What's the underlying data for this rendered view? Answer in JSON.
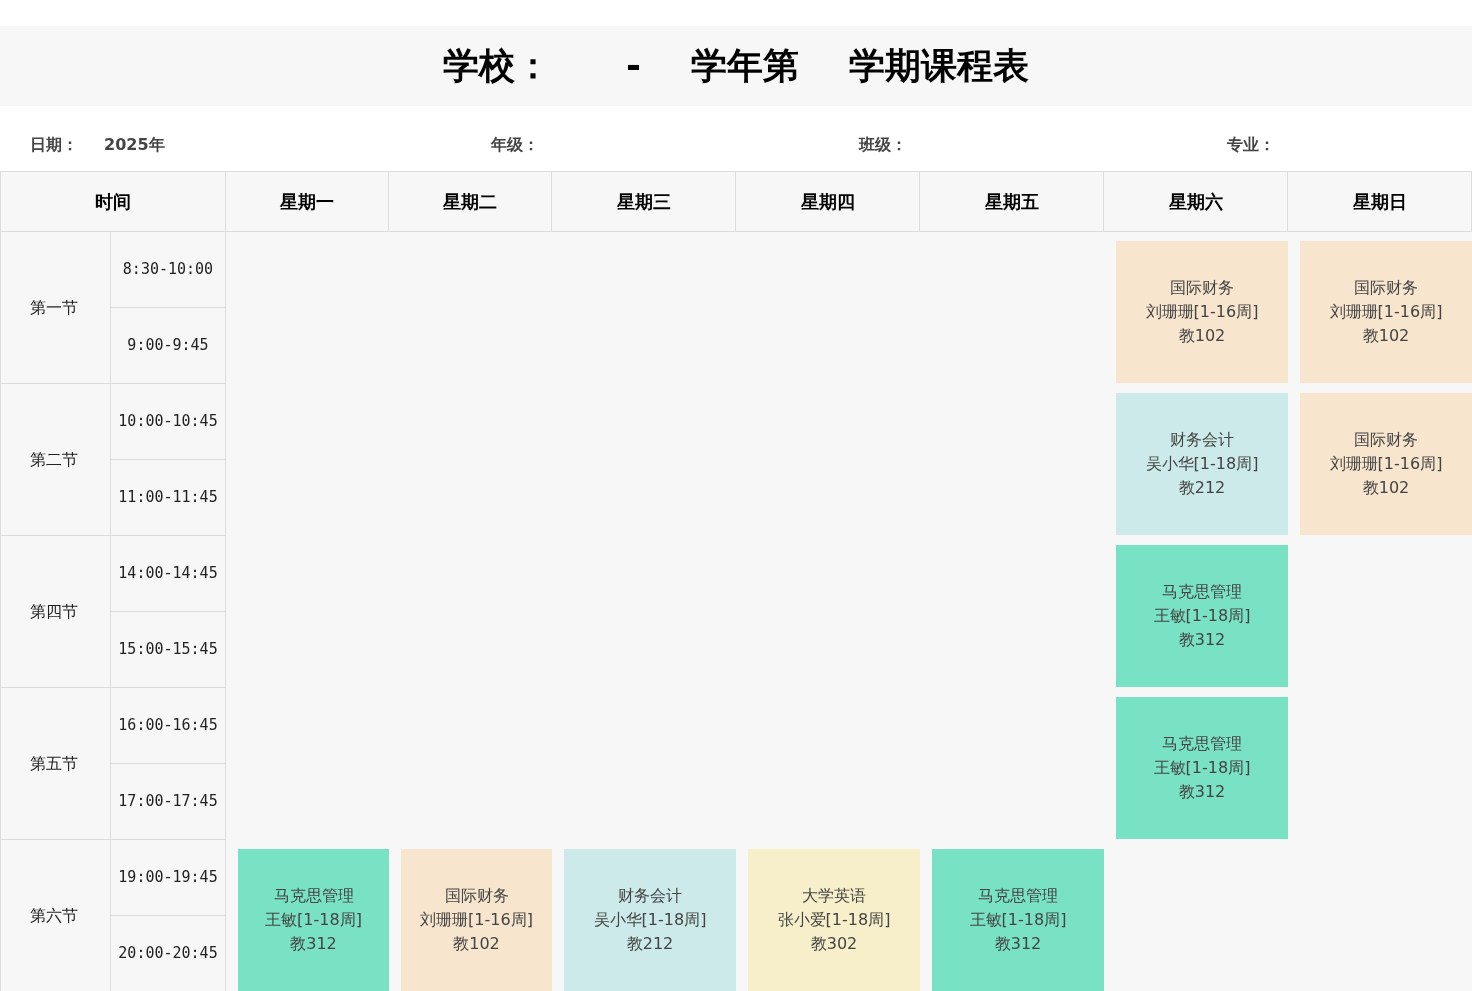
{
  "title": "学校：      -    学年第    学期课程表",
  "info": [
    {
      "label": "日期：",
      "value": "2025年"
    },
    {
      "label": "年级："
    },
    {
      "label": "班级："
    },
    {
      "label": "专业："
    }
  ],
  "table": {
    "columns": [
      "时间",
      "星期一",
      "星期二",
      "星期三",
      "星期四",
      "星期五",
      "星期六",
      "星期日"
    ],
    "periods": [
      {
        "label": "第一节",
        "times": [
          "8:30-10:00",
          "9:00-9:45"
        ],
        "cells": [
          null,
          null,
          null,
          null,
          null,
          {
            "course": "国际财务",
            "teacher": "刘珊珊[1-16周]",
            "room": "教102",
            "color": "#f8e5ce"
          },
          {
            "course": "国际财务",
            "teacher": "刘珊珊[1-16周]",
            "room": "教102",
            "color": "#f8e5ce"
          }
        ]
      },
      {
        "label": "第二节",
        "times": [
          "10:00-10:45",
          "11:00-11:45"
        ],
        "cells": [
          null,
          null,
          null,
          null,
          null,
          {
            "course": "财务会计",
            "teacher": "吴小华[1-18周]",
            "room": "教212",
            "color": "#cdeaea"
          },
          {
            "course": "国际财务",
            "teacher": "刘珊珊[1-16周]",
            "room": "教102",
            "color": "#f8e5ce"
          }
        ]
      },
      {
        "label": "第四节",
        "times": [
          "14:00-14:45",
          "15:00-15:45"
        ],
        "cells": [
          null,
          null,
          null,
          null,
          null,
          {
            "course": "马克思管理",
            "teacher": "王敏[1-18周]",
            "room": "教312",
            "color": "#79e2c4"
          },
          null
        ]
      },
      {
        "label": "第五节",
        "times": [
          "16:00-16:45",
          "17:00-17:45"
        ],
        "cells": [
          null,
          null,
          null,
          null,
          null,
          {
            "course": "马克思管理",
            "teacher": "王敏[1-18周]",
            "room": "教312",
            "color": "#79e2c4"
          },
          null
        ]
      },
      {
        "label": "第六节",
        "times": [
          "19:00-19:45",
          "20:00-20:45"
        ],
        "cells": [
          {
            "course": "马克思管理",
            "teacher": "王敏[1-18周]",
            "room": "教312",
            "color": "#79e2c4"
          },
          {
            "course": "国际财务",
            "teacher": "刘珊珊[1-16周]",
            "room": "教102",
            "color": "#f8e5ce"
          },
          {
            "course": "财务会计",
            "teacher": "吴小华[1-18周]",
            "room": "教212",
            "color": "#cdeaea"
          },
          {
            "course": "大学英语",
            "teacher": "张小爱[1-18周]",
            "room": "教302",
            "color": "#f7efca"
          },
          {
            "course": "马克思管理",
            "teacher": "王敏[1-18周]",
            "room": "教312",
            "color": "#79e2c4"
          },
          null,
          null
        ]
      }
    ]
  }
}
